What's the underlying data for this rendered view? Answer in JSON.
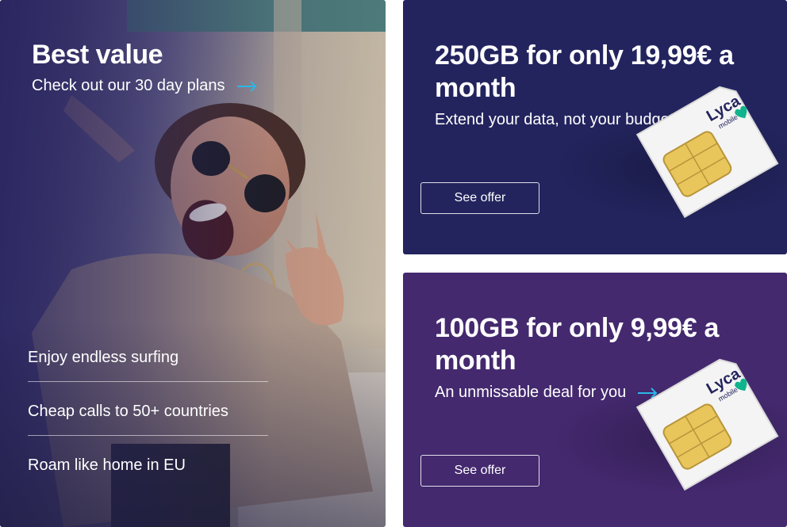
{
  "hero": {
    "title": "Best value",
    "link_text": "Check out our 30 day plans",
    "features": [
      "Enjoy endless surfing",
      "Cheap calls to 50+ countries",
      "Roam like home in EU"
    ]
  },
  "offers": [
    {
      "title": "250GB for only 19,99€ a month",
      "subtitle": "Extend your data, not your budget",
      "button": "See offer",
      "sim_brand": "Lyca",
      "sim_sub": "mobile"
    },
    {
      "title": "100GB for only 9,99€ a month",
      "subtitle": "An unmissable deal for you",
      "button": "See offer",
      "sim_brand": "Lyca",
      "sim_sub": "mobile"
    }
  ],
  "colors": {
    "offer1_bg": "#23245e",
    "offer2_bg": "#44296f",
    "arrow": "#2bb6e8",
    "sim_heart": "#10b48c",
    "chip_gold": "#e9c65c"
  }
}
